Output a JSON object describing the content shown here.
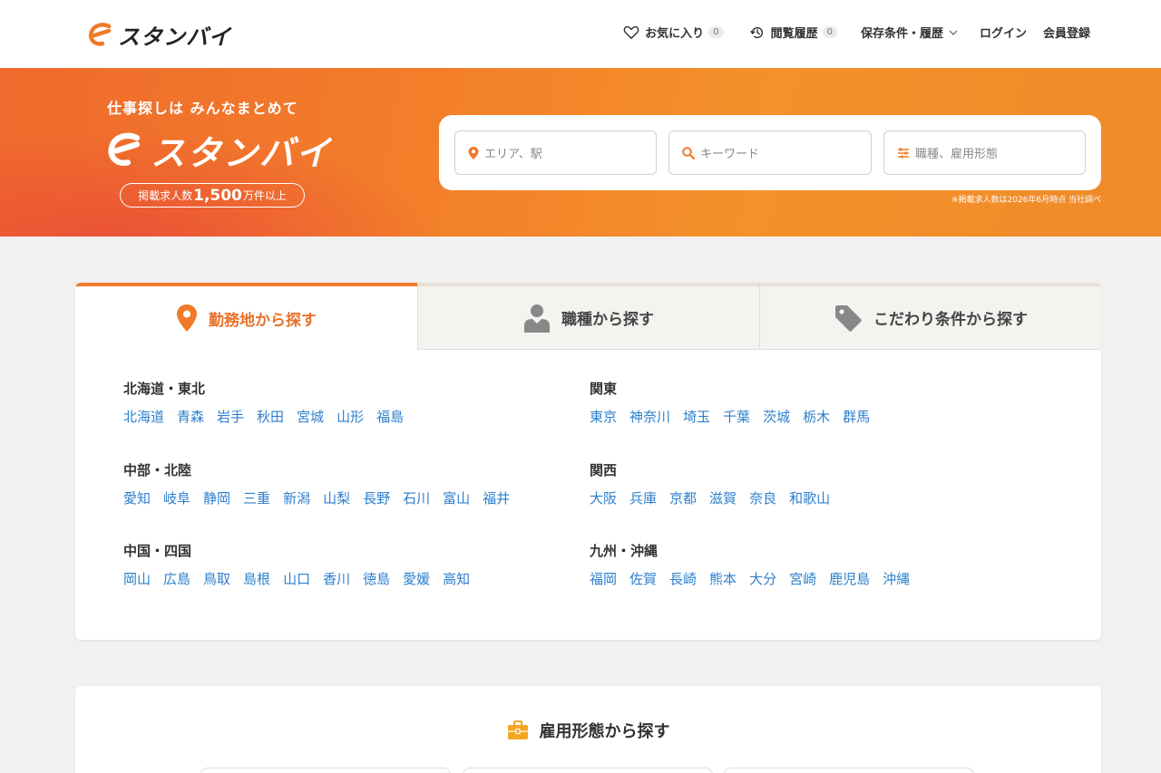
{
  "header": {
    "logo_text": "スタンバイ",
    "favorites_label": "お気に入り",
    "favorites_count": "0",
    "history_label": "閲覧履歴",
    "history_count": "0",
    "saved_label": "保存条件・履歴",
    "login_label": "ログイン",
    "register_label": "会員登録"
  },
  "hero": {
    "tagline": "仕事探しは みんなまとめて",
    "logo_text": "スタンバイ",
    "pill_prefix": "掲載求人数",
    "pill_number": "1,500",
    "pill_suffix": "万件以上",
    "note": "※掲載求人数は2026年6月時点 当社調べ"
  },
  "search": {
    "area_placeholder": "エリア、駅",
    "keyword_placeholder": "キーワード",
    "jobtype_placeholder": "職種、雇用形態"
  },
  "tabs": [
    {
      "label": "勤務地から探す"
    },
    {
      "label": "職種から探す"
    },
    {
      "label": "こだわり条件から探す"
    }
  ],
  "regions": [
    {
      "title": "北海道・東北",
      "prefectures": [
        "北海道",
        "青森",
        "岩手",
        "秋田",
        "宮城",
        "山形",
        "福島"
      ]
    },
    {
      "title": "関東",
      "prefectures": [
        "東京",
        "神奈川",
        "埼玉",
        "千葉",
        "茨城",
        "栃木",
        "群馬"
      ]
    },
    {
      "title": "中部・北陸",
      "prefectures": [
        "愛知",
        "岐阜",
        "静岡",
        "三重",
        "新潟",
        "山梨",
        "長野",
        "石川",
        "富山",
        "福井"
      ]
    },
    {
      "title": "関西",
      "prefectures": [
        "大阪",
        "兵庫",
        "京都",
        "滋賀",
        "奈良",
        "和歌山"
      ]
    },
    {
      "title": "中国・四国",
      "prefectures": [
        "岡山",
        "広島",
        "鳥取",
        "島根",
        "山口",
        "香川",
        "徳島",
        "愛媛",
        "高知"
      ]
    },
    {
      "title": "九州・沖縄",
      "prefectures": [
        "福岡",
        "佐賀",
        "長崎",
        "熊本",
        "大分",
        "宮崎",
        "鹿児島",
        "沖縄"
      ]
    }
  ],
  "employment": {
    "title": "雇用形態から探す"
  },
  "colors": {
    "brand_orange": "#f07a2b",
    "link_blue": "#2c7fce"
  }
}
